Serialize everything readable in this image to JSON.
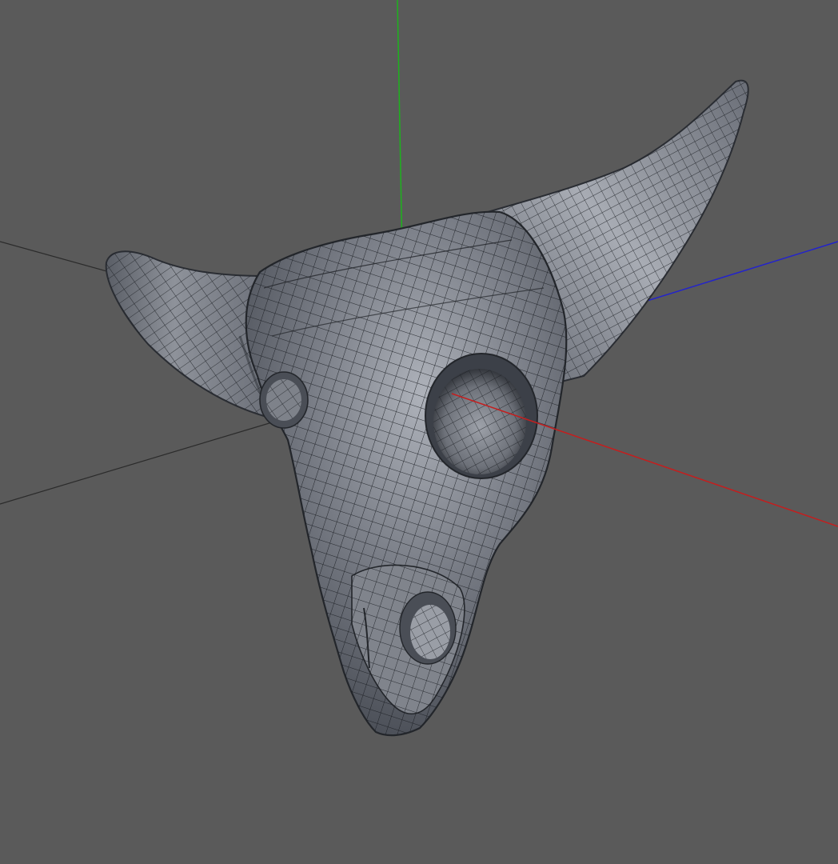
{
  "viewport": {
    "background_color": "#5a5a5a",
    "model_name": "bull-skull-wireframe-mesh"
  },
  "axes": {
    "y_axis_color": "#1db21d",
    "z_axis_color": "#2323cc",
    "x_axis_color": "#c41e1e",
    "grid_line_color": "#2b2b2b"
  },
  "mesh": {
    "fill_color": "#6c7078",
    "highlight_color": "#b4b8c0",
    "shadow_color": "#3c4048",
    "wire_color": "#1a1d22"
  }
}
